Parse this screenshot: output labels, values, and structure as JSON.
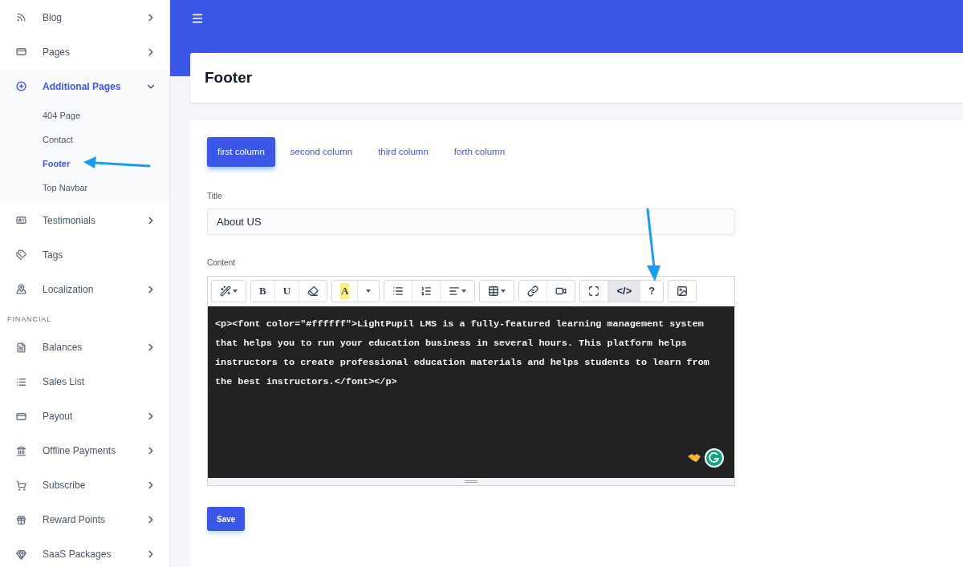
{
  "sidebar": {
    "items": [
      {
        "kind": "item",
        "label": "Blog",
        "has_submenu": true,
        "expanded": false,
        "selected": false
      },
      {
        "kind": "item",
        "label": "Pages",
        "has_submenu": true,
        "expanded": false,
        "selected": false
      },
      {
        "kind": "item",
        "label": "Additional Pages",
        "has_submenu": true,
        "selected": true,
        "expanded": true,
        "children": [
          {
            "label": "404 Page",
            "selected": false
          },
          {
            "label": "Contact",
            "selected": false
          },
          {
            "label": "Footer",
            "selected": true
          },
          {
            "label": "Top Navbar",
            "selected": false
          }
        ]
      },
      {
        "kind": "item",
        "label": "Testimonials",
        "has_submenu": true,
        "expanded": false,
        "selected": false
      },
      {
        "kind": "item",
        "label": "Tags",
        "has_submenu": false,
        "selected": false
      },
      {
        "kind": "item",
        "label": "Localization",
        "has_submenu": true,
        "expanded": false,
        "selected": false
      },
      {
        "kind": "section",
        "label": "FINANCIAL"
      },
      {
        "kind": "item",
        "label": "Balances",
        "has_submenu": true,
        "expanded": false,
        "selected": false
      },
      {
        "kind": "item",
        "label": "Sales List",
        "has_submenu": false,
        "selected": false
      },
      {
        "kind": "item",
        "label": "Payout",
        "has_submenu": true,
        "expanded": false,
        "selected": false
      },
      {
        "kind": "item",
        "label": "Offline Payments",
        "has_submenu": true,
        "expanded": false,
        "selected": false
      },
      {
        "kind": "item",
        "label": "Subscribe",
        "has_submenu": true,
        "expanded": false,
        "selected": false
      },
      {
        "kind": "item",
        "label": "Reward Points",
        "has_submenu": true,
        "expanded": false,
        "selected": false
      },
      {
        "kind": "item",
        "label": "SaaS Packages",
        "has_submenu": true,
        "expanded": false,
        "selected": false
      }
    ]
  },
  "page_title": "Footer",
  "tabs": [
    {
      "label": "first column",
      "selected": true
    },
    {
      "label": "second column",
      "selected": false
    },
    {
      "label": "third column",
      "selected": false
    },
    {
      "label": "forth column",
      "selected": false
    }
  ],
  "title_field": {
    "label": "Title",
    "value": "About US"
  },
  "content_field": {
    "label": "Content",
    "toolbar": [
      [
        {
          "selected": false,
          "dropdown": true
        }
      ],
      [
        {
          "label": "B",
          "selected": false
        },
        {
          "label": "U",
          "selected": false
        },
        {
          "selected": false
        }
      ],
      [
        {
          "label": "A",
          "selected": false
        },
        {
          "selected": false,
          "dropdown": true
        }
      ],
      [
        {
          "selected": false
        },
        {
          "selected": false
        },
        {
          "selected": false,
          "dropdown": true
        }
      ],
      [
        {
          "selected": false,
          "dropdown": true
        }
      ],
      [
        {
          "selected": false
        },
        {
          "selected": false
        }
      ],
      [
        {
          "selected": false
        },
        {
          "label": "</>",
          "selected": true
        },
        {
          "label": "?",
          "selected": false
        }
      ],
      [
        {
          "selected": false
        }
      ]
    ],
    "code": "<p><font color=\"#ffffff\">LightPupil LMS is a fully-featured learning management system that helps you to run your education business in several hours. This platform helps instructors to create professional education materials and helps students to learn from the best instructors.</font></p>"
  },
  "save_button": "Save"
}
